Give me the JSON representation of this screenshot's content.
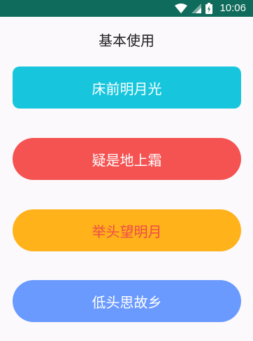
{
  "status_bar": {
    "time": "10:06",
    "icons": [
      "wifi-icon",
      "signal-icon",
      "battery-icon"
    ],
    "background": "#0f6b5b"
  },
  "page": {
    "title": "基本使用"
  },
  "buttons": [
    {
      "label": "床前明月光",
      "background": "#17c6dd",
      "text_color": "#ffffff"
    },
    {
      "label": "疑是地上霜",
      "background": "#f55252",
      "text_color": "#ffffff"
    },
    {
      "label": "举头望明月",
      "background": "#ffb21a",
      "text_color": "#ef4a4a"
    },
    {
      "label": "低头思故乡",
      "background": "#6b9aff",
      "text_color": "#ffffff"
    }
  ]
}
